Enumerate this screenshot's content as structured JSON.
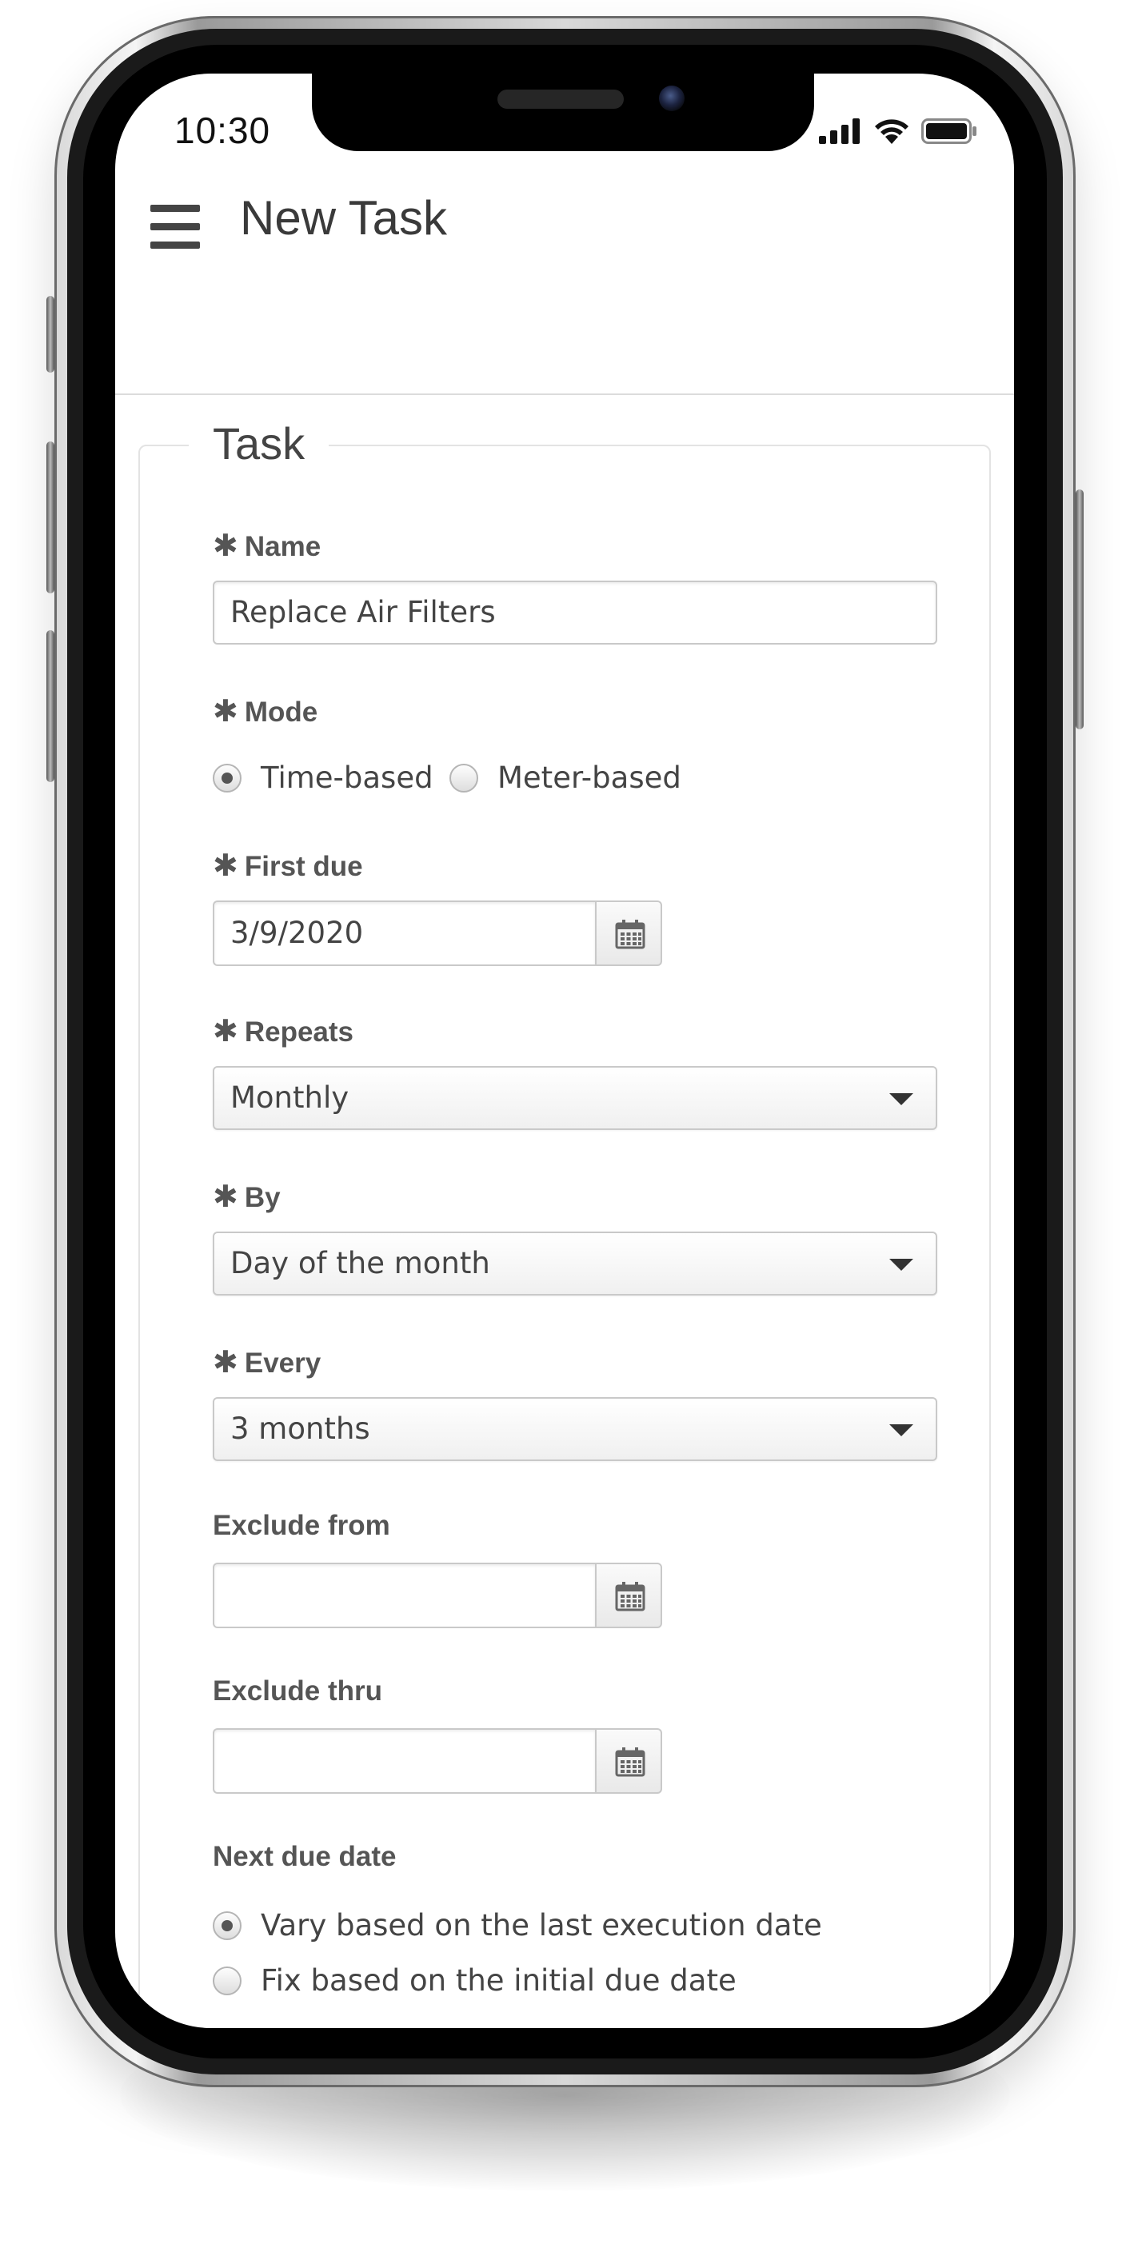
{
  "status_bar": {
    "time": "10:30"
  },
  "app_bar": {
    "title": "New Task"
  },
  "form": {
    "legend": "Task",
    "name": {
      "label": "Name",
      "value": "Replace Air Filters"
    },
    "mode": {
      "label": "Mode",
      "options": [
        {
          "label": "Time-based",
          "checked": true
        },
        {
          "label": "Meter-based",
          "checked": false
        }
      ]
    },
    "first_due": {
      "label": "First due",
      "value": "3/9/2020"
    },
    "repeats": {
      "label": "Repeats",
      "value": "Monthly"
    },
    "by": {
      "label": "By",
      "value": "Day of the month"
    },
    "every": {
      "label": "Every",
      "value": "3 months"
    },
    "exclude_from": {
      "label": "Exclude from",
      "value": ""
    },
    "exclude_thru": {
      "label": "Exclude thru",
      "value": ""
    },
    "next_due": {
      "label": "Next due date",
      "options": [
        {
          "label": "Vary based on the last execution date",
          "checked": true
        },
        {
          "label": "Fix based on the initial due date",
          "checked": false
        }
      ]
    },
    "required_marker": "✱"
  },
  "icons": {
    "menu": "hamburger-menu-icon",
    "calendar": "calendar-icon",
    "dropdown": "caret-down-icon",
    "signal": "cellular-signal-icon",
    "wifi": "wifi-icon",
    "battery": "battery-icon"
  },
  "colors": {
    "label_text": "#555555",
    "title_text": "#3a3a3a",
    "border": "#c9c9c9"
  }
}
